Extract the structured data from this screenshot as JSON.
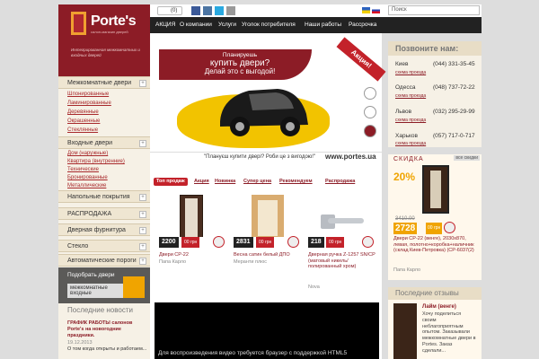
{
  "logo": {
    "name": "Porte's",
    "tagline": "салон-магазин дверей",
    "desc": "Интегрированная межкомнатных и входных дверей"
  },
  "left_menu": [
    {
      "label": "Межкомнатные двери",
      "subs": [
        "Шпонированные",
        "Ламинированные",
        "Деревянные",
        "Окрашенные",
        "Стеклянные"
      ]
    },
    {
      "label": "Входные двери",
      "subs": [
        "Дом (наружные)",
        "Квартира (внутренние)",
        "Технические",
        "Бронированные",
        "Металлические"
      ]
    },
    {
      "label": "Напольные покрытия",
      "subs": []
    },
    {
      "label": "РАСПРОДАЖА",
      "subs": []
    },
    {
      "label": "Дверная фурнитура",
      "subs": []
    },
    {
      "label": "Стекло",
      "subs": []
    },
    {
      "label": "Автоматические пороги",
      "subs": []
    }
  ],
  "pick_door": {
    "line1": "Подобрать двери",
    "line2": "межкомнатные входные"
  },
  "news": {
    "title": "Последние новости",
    "item_title": "ГРАФИК РАБОТЫ салонов Porte's на новогодние праздники.",
    "item_date": "19.12.2013",
    "item_text": "О том когда открыты и работаем..."
  },
  "topbar": {
    "cart_count": "(0)",
    "search_placeholder": "Поиск"
  },
  "nav": [
    "АКЦИЯ",
    "О компании",
    "Услуги",
    "Уголок потребителя",
    "Наши работы",
    "Рассрочка"
  ],
  "banner": {
    "line1": "Планируешь",
    "line2": "купить двери?",
    "line3": "Делай это с выгодой!",
    "slogan": "\"Плануєш купити двері? Роби це з вигодою!\"",
    "url": "www.portes.ua",
    "ribbon": "Акция!"
  },
  "tabs": [
    "Топ продаж",
    "Акция",
    "Новинка",
    "Супер цена",
    "Рекомендуем",
    "Распродажа"
  ],
  "products": [
    {
      "price": "2200",
      "cur": "00 грн",
      "name": "Двери CP-22",
      "maker": "Папа Карло"
    },
    {
      "price": "2831",
      "cur": "00 грн",
      "name": "Весна сатин белый ДПО",
      "maker": "Меранти плюс"
    },
    {
      "price": "218",
      "cur": "00 грн",
      "name": "Дверная ручка Z-1257 SN/CP (матовый никель/полированный хром)",
      "maker": "Nova"
    }
  ],
  "video_msg": "Для воспроизведения видео требуется браузер с поддержкой HTML5",
  "call": {
    "title": "Позвоните нам:",
    "map_label": "схема проезда",
    "cities": [
      {
        "city": "Киев",
        "phone": "(044) 331-35-45"
      },
      {
        "city": "Одесса",
        "phone": "(048) 737-72-22"
      },
      {
        "city": "Львов",
        "phone": "(032) 295-29-99"
      },
      {
        "city": "Харьков",
        "phone": "(057) 717-0-717"
      }
    ]
  },
  "sale": {
    "label": "СКИДКА",
    "all": "все скидки",
    "pct": "20%",
    "old": "3410.00",
    "price": "2728",
    "cur": "00 грн",
    "desc": "Двери CP-22 (венге), 2030x870, левая, полотно+коробка+наличник (склад Киев-Петровка) (CP-6037(2)",
    "maker": "Папа Карло"
  },
  "reviews": {
    "title": "Последние отзывы",
    "name": "Лайм (венге)",
    "text": "Хочу поделиться своим неблагоприятным опытом. Заказывали межкомнатные двери в Portes. Заказ сделали..."
  }
}
